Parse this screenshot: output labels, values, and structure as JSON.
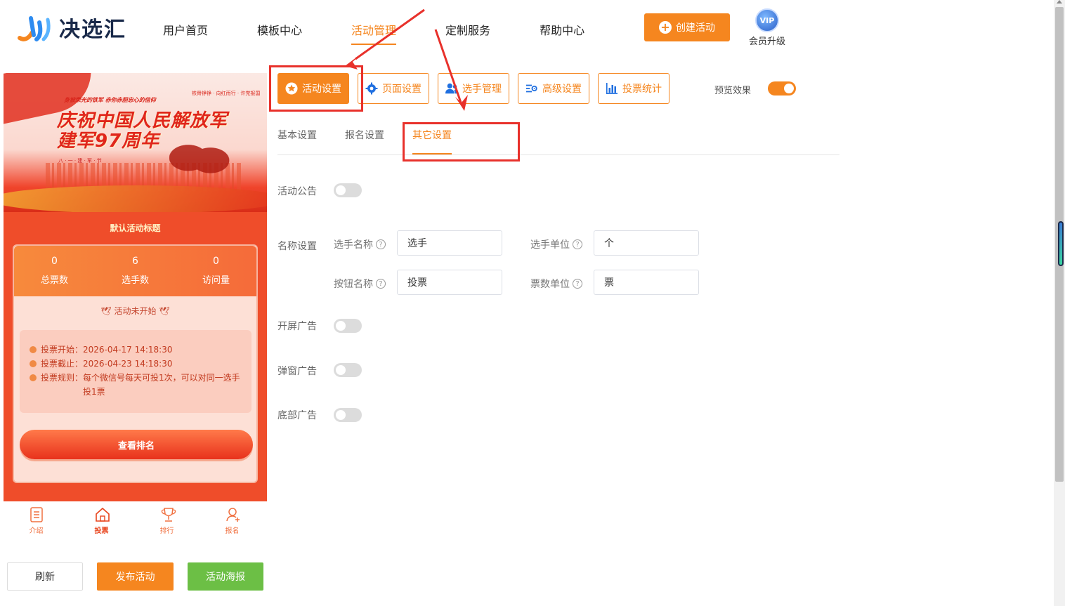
{
  "header": {
    "logo_text": "决选汇",
    "nav": [
      "用户首页",
      "模板中心",
      "活动管理",
      "定制服务",
      "帮助中心"
    ],
    "active_nav_index": 2,
    "create_button": "创建活动",
    "vip_badge": "VIP",
    "vip_label": "会员升级"
  },
  "preview": {
    "banner": {
      "slogan_left": "身披荣光的铁军 赤你赤胆忠心的信仰",
      "slogan_right": "铁骨铮铮 · 向红而行 · 许党报国",
      "title_line1": "庆祝中国人民解放军",
      "title_line2": "建军97周年",
      "subline": "八 · 一 · 建 · 军 · 节"
    },
    "event_title": "默认活动标题",
    "stats": [
      {
        "value": "0",
        "label": "总票数"
      },
      {
        "value": "6",
        "label": "选手数"
      },
      {
        "value": "0",
        "label": "访问量"
      }
    ],
    "status": "活动未开始",
    "info": [
      {
        "key": "投票开始：",
        "value": "2026-04-17 14:18:30"
      },
      {
        "key": "投票截止：",
        "value": "2026-04-23 14:18:30"
      },
      {
        "key": "投票规则：",
        "value": "每个微信号每天可投1次，可以对同一选手投1票"
      }
    ],
    "rank_button": "查看排名",
    "tabbar": [
      {
        "label": "介绍",
        "icon": "list-icon"
      },
      {
        "label": "投票",
        "icon": "home-icon"
      },
      {
        "label": "排行",
        "icon": "trophy-icon"
      },
      {
        "label": "报名",
        "icon": "user-add-icon"
      }
    ],
    "active_tab_index": 1
  },
  "bottom_buttons": {
    "refresh": "刷新",
    "publish": "发布活动",
    "poster": "活动海报"
  },
  "toolbar": {
    "buttons": [
      {
        "label": "活动设置",
        "icon": "star-icon"
      },
      {
        "label": "页面设置",
        "icon": "gear-icon"
      },
      {
        "label": "选手管理",
        "icon": "users-icon"
      },
      {
        "label": "高级设置",
        "icon": "sliders-icon"
      },
      {
        "label": "投票统计",
        "icon": "bar-chart-icon"
      }
    ],
    "active_index": 0,
    "preview_label": "预览效果",
    "preview_on": true
  },
  "sub_tabs": {
    "items": [
      "基本设置",
      "报名设置",
      "其它设置"
    ],
    "active_index": 2
  },
  "form": {
    "announcement_label": "活动公告",
    "announcement_on": false,
    "name_settings_label": "名称设置",
    "fields": [
      {
        "label": "选手名称",
        "value": "选手"
      },
      {
        "label": "选手单位",
        "value": "个"
      },
      {
        "label": "按钮名称",
        "value": "投票"
      },
      {
        "label": "票数单位",
        "value": "票"
      }
    ],
    "splash_ad_label": "开屏广告",
    "splash_ad_on": false,
    "popup_ad_label": "弹窗广告",
    "popup_ad_on": false,
    "bottom_ad_label": "底部广告",
    "bottom_ad_on": false
  },
  "colors": {
    "accent": "#f5861f",
    "annotation_red": "#e8312b",
    "poster_green": "#6cbf45"
  }
}
